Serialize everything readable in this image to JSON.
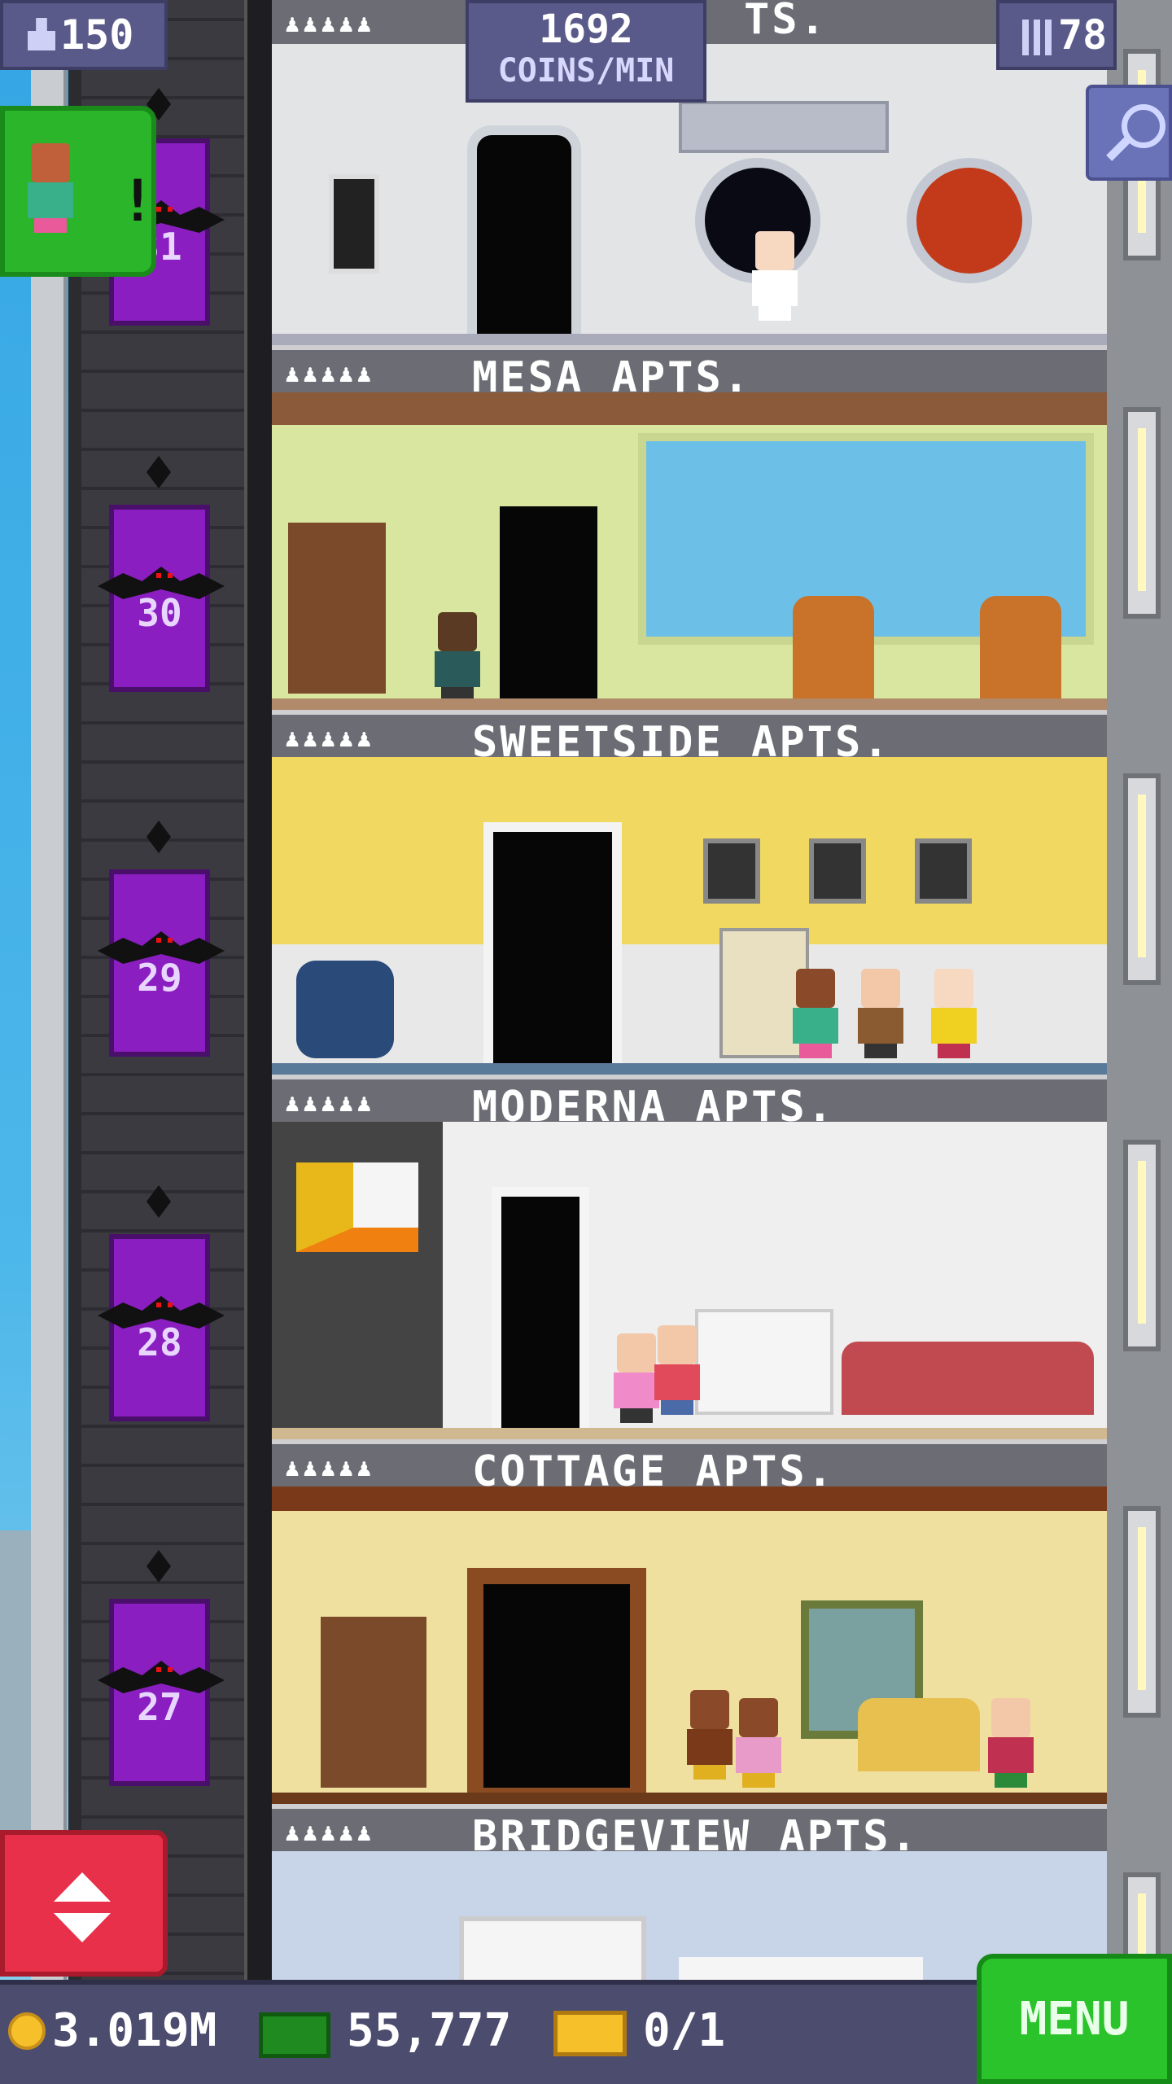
{
  "hud": {
    "population": "150",
    "coins_per_min": "1692",
    "coins_per_min_label": "COINS/MIN",
    "floor_count": "78",
    "coins": "3.019M",
    "bux": "55,777",
    "tickets": "0/1",
    "menu_label": "MENU",
    "pop_icon": "person-icon",
    "floors_icon": "building-icon",
    "search_icon": "magnifier-icon"
  },
  "top_sign_partial": "TS.",
  "floors": [
    {
      "name": "MESA APTS.",
      "pips": "♟♟♟♟♟"
    },
    {
      "name": "SWEETSIDE APTS.",
      "pips": "♟♟♟♟♟"
    },
    {
      "name": "MODERNA APTS.",
      "pips": "♟♟♟♟♟"
    },
    {
      "name": "COTTAGE APTS.",
      "pips": "♟♟♟♟♟"
    },
    {
      "name": "BRIDGEVIEW APTS.",
      "pips": "♟♟♟♟♟"
    }
  ],
  "top_pips": "♟♟♟♟♟",
  "elevator_floors": [
    "31",
    "30",
    "29",
    "28",
    "27"
  ],
  "colors": {
    "accent_green": "#2bc32b",
    "elevator_purple": "#8a1ec0",
    "hud_blue": "#5a5a8a",
    "elevator_button_red": "#e8304a"
  }
}
